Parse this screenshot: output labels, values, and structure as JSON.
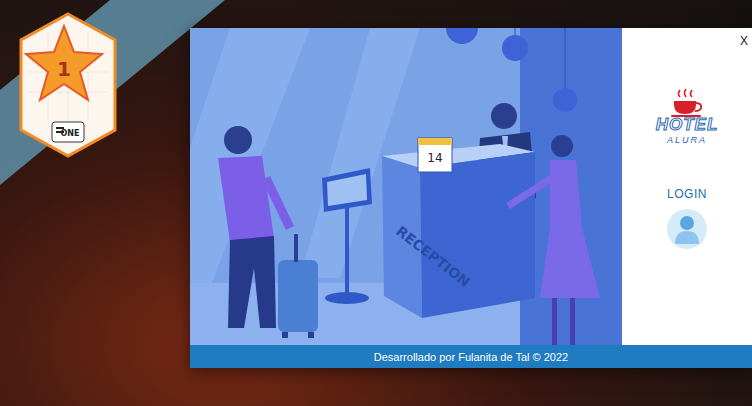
{
  "badge": {
    "number": "1",
    "brand": "ONE"
  },
  "illustration": {
    "sign": "RECEPTION",
    "calendar_day": "14"
  },
  "close_button": "X",
  "logo": {
    "title": "HOTEL",
    "subtitle": "ALURA"
  },
  "login": {
    "label": "LOGIN"
  },
  "footer": "Desarrollado por Fulanita de Tal © 2022"
}
